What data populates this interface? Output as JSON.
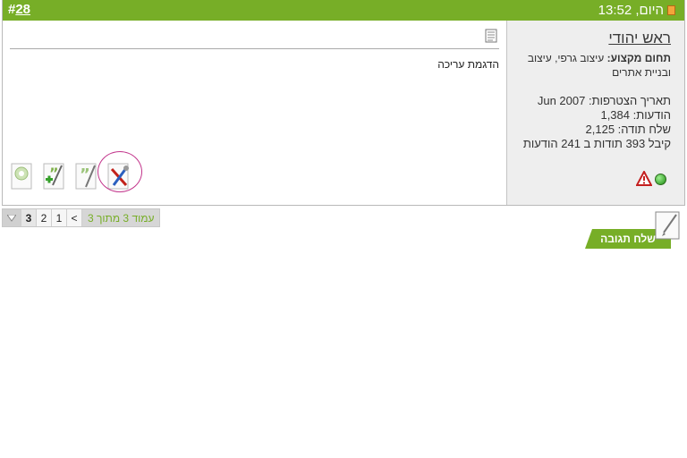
{
  "post": {
    "number_prefix": "#",
    "number": "28",
    "date": "היום, 13:52",
    "header_color": "#77ae27"
  },
  "user": {
    "name": "ראש יהודי",
    "field_label": "תחום מקצוע:",
    "field_value": "עיצוב גרפי, עיצוב ובניית אתרים",
    "joined": "תאריך הצטרפות: Jun 2007",
    "posts": "הודעות: 1,384",
    "thanks_given": "שלח תודה: 2,125",
    "thanks_received": "קיבל 393 תודות ב 241 הודעות"
  },
  "message": {
    "text": "הדגמת עריכה"
  },
  "actions": {
    "icons": [
      "edit-icon",
      "quote-icon",
      "multi-quote-icon",
      "quick-reply-icon"
    ]
  },
  "pagination": {
    "label": "עמוד 3 מתוך 3",
    "prev": "<",
    "pages": [
      "1",
      "2",
      "3"
    ],
    "current": "3"
  },
  "reply": {
    "label": "שלח תגובה"
  }
}
